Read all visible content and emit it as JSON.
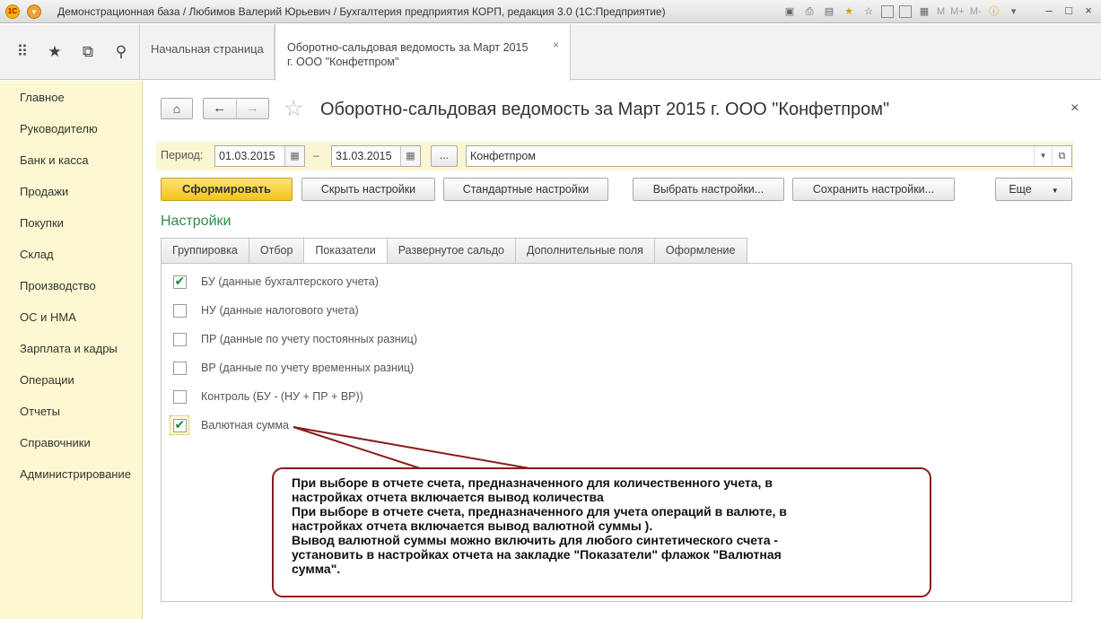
{
  "titlebar": {
    "title": "Демонстрационная база / Любимов Валерий Юрьевич / Бухгалтерия предприятия КОРП, редакция 3.0  (1С:Предприятие)",
    "m_label": "M",
    "mplus_label": "M+",
    "mminus_label": "M-"
  },
  "top_tabs": {
    "home": "Начальная страница",
    "active_line1": "Оборотно-сальдовая ведомость за Март 2015",
    "active_line2": "г. ООО \"Конфетпром\""
  },
  "sidebar": {
    "items": [
      {
        "label": "Главное"
      },
      {
        "label": "Руководителю"
      },
      {
        "label": "Банк и касса"
      },
      {
        "label": "Продажи"
      },
      {
        "label": "Покупки"
      },
      {
        "label": "Склад"
      },
      {
        "label": "Производство"
      },
      {
        "label": "ОС и НМА"
      },
      {
        "label": "Зарплата и кадры"
      },
      {
        "label": "Операции"
      },
      {
        "label": "Отчеты"
      },
      {
        "label": "Справочники"
      },
      {
        "label": "Администрирование"
      }
    ]
  },
  "main": {
    "title": "Оборотно-сальдовая ведомость за Март 2015 г. ООО \"Конфетпром\"",
    "period_label": "Период:",
    "date_from": "01.03.2015",
    "date_dash": "–",
    "date_to": "31.03.2015",
    "dots": "...",
    "organization": "Конфетпром",
    "buttons": {
      "generate": "Сформировать",
      "hide_settings": "Скрыть настройки",
      "standard_settings": "Стандартные настройки",
      "choose_settings": "Выбрать настройки...",
      "save_settings": "Сохранить настройки...",
      "more": "Еще"
    },
    "section_title": "Настройки",
    "tabs": [
      {
        "label": "Группировка"
      },
      {
        "label": "Отбор"
      },
      {
        "label": "Показатели"
      },
      {
        "label": "Развернутое сальдо"
      },
      {
        "label": "Дополнительные поля"
      },
      {
        "label": "Оформление"
      }
    ],
    "checkboxes": [
      {
        "label": "БУ (данные бухгалтерского учета)",
        "checked": true
      },
      {
        "label": "НУ (данные налогового учета)",
        "checked": false
      },
      {
        "label": "ПР (данные по учету постоянных разниц)",
        "checked": false
      },
      {
        "label": "ВР (данные по учету временных разниц)",
        "checked": false
      },
      {
        "label": "Контроль (БУ - (НУ + ПР + ВР))",
        "checked": false
      },
      {
        "label": "Валютная сумма",
        "checked": true
      }
    ]
  },
  "callout": {
    "lines": [
      "При выборе в отчете счета, предназначенного для количественного учета, в",
      "настройках отчета включается вывод количества",
      "При выборе в отчете счета, предназначенного для учета операций в валюте, в",
      "настройках отчета включается вывод валютной суммы ).",
      "Вывод валютной суммы можно включить для любого синтетического счета -",
      "установить в настройках отчета на закладке \"Показатели\" флажок \"Валютная",
      "сумма\"."
    ],
    "border_color": "#8a1c1c"
  },
  "colors": {
    "sidebar_bg": "#fdf8d2",
    "primary_button": "#f3c41e",
    "section_title": "#2e8b4e"
  }
}
